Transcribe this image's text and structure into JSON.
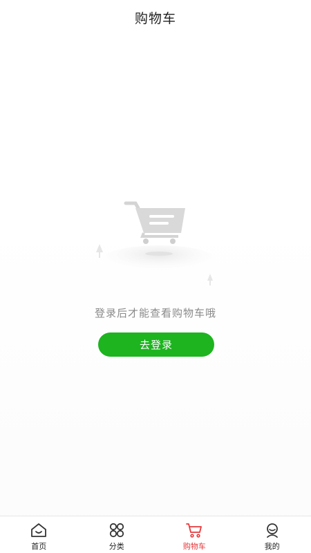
{
  "header": {
    "title": "购物车"
  },
  "empty_state": {
    "illustration": "empty-cart-illustration",
    "message": "登录后才能查看购物车哦",
    "login_button_label": "去登录"
  },
  "colors": {
    "accent": "#1db41f",
    "active_tab": "#e4393c",
    "text_muted": "#8a8a8a"
  },
  "tabbar": {
    "items": [
      {
        "label": "首页",
        "icon": "home-icon",
        "active": false
      },
      {
        "label": "分类",
        "icon": "category-icon",
        "active": false
      },
      {
        "label": "购物车",
        "icon": "cart-icon",
        "active": true
      },
      {
        "label": "我的",
        "icon": "profile-icon",
        "active": false
      }
    ]
  }
}
